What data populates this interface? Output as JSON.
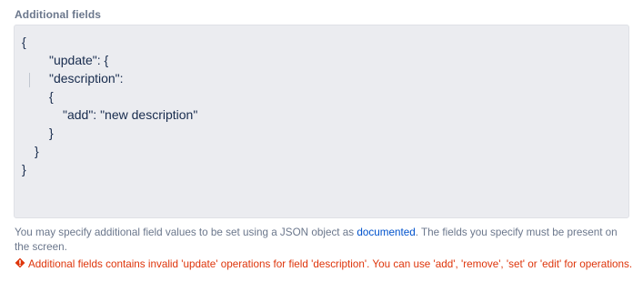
{
  "field": {
    "label": "Additional fields"
  },
  "editor": {
    "lines": [
      {
        "indent": 0,
        "text": "{"
      },
      {
        "indent": 1,
        "text": "\"update\": {"
      },
      {
        "indent": 1,
        "text": "\"description\":"
      },
      {
        "indent": 1,
        "text": "{"
      },
      {
        "indent": 2,
        "text": "\"add\": \"new description\""
      },
      {
        "indent": 1,
        "text": "}"
      },
      {
        "indent": 0.5,
        "text": "}"
      },
      {
        "indent": 0,
        "text": "}"
      }
    ]
  },
  "help": {
    "before_link": "You may specify additional field values to be set using a JSON object as ",
    "link_text": "documented",
    "after_link": ". The fields you specify must be present on the screen."
  },
  "error": {
    "icon": "error-icon",
    "color": "#de350b",
    "message": "Additional fields contains invalid 'update' operations for field 'description'. You can use 'add', 'remove', 'set' or 'edit' for operations."
  },
  "colors": {
    "editor_bg": "#ebecf0",
    "link": "#0052cc",
    "muted_text": "#6b778c"
  }
}
